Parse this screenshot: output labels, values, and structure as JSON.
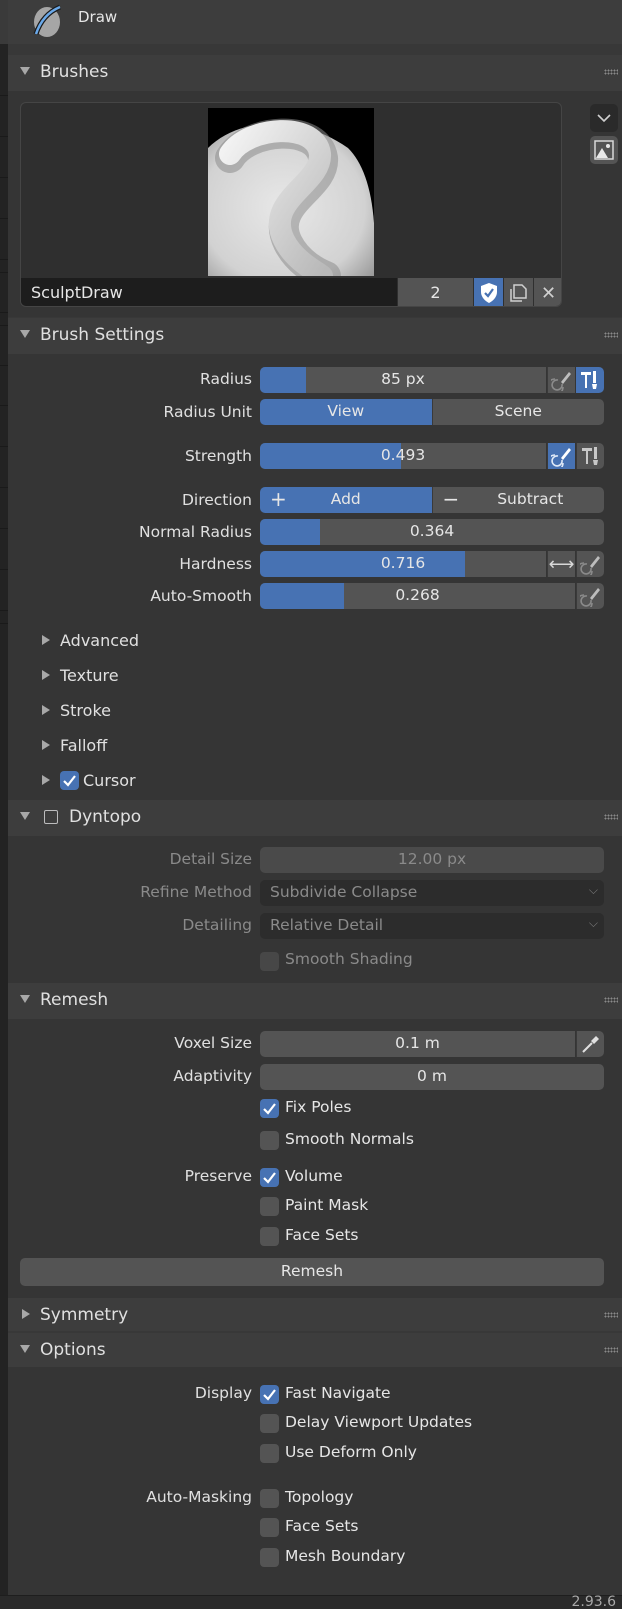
{
  "tool": {
    "name": "Draw",
    "icon": "draw-brush-icon"
  },
  "colors": {
    "accent": "#4772b3",
    "panel": "#383838",
    "header": "#3d3d3d",
    "field": "#545454"
  },
  "brushes": {
    "title": "Brushes",
    "brush_name": "SculptDraw",
    "users": "2",
    "fake_user_icon": "shield-check-icon",
    "duplicate_icon": "duplicate-icon",
    "delete_icon": "close-icon",
    "delete_glyph": "✕",
    "side_icons": [
      "chevron-down-icon",
      "image-icon"
    ]
  },
  "brush_settings": {
    "title": "Brush Settings",
    "radius": {
      "label": "Radius",
      "value": "85 px",
      "fill_fraction": 0.16
    },
    "radius_unit": {
      "label": "Radius Unit",
      "options": [
        "View",
        "Scene"
      ],
      "selected": "View"
    },
    "strength": {
      "label": "Strength",
      "value": "0.493",
      "fill_fraction": 0.493
    },
    "direction": {
      "label": "Direction",
      "options": [
        {
          "symbol": "+",
          "label": "Add"
        },
        {
          "symbol": "−",
          "label": "Subtract"
        }
      ],
      "selected": "Add"
    },
    "normal_radius": {
      "label": "Normal Radius",
      "value": "0.364",
      "fill_fraction": 0.175
    },
    "hardness": {
      "label": "Hardness",
      "value": "0.716",
      "fill_fraction": 0.716,
      "arrows_glyph": "⟷"
    },
    "auto_smooth": {
      "label": "Auto-Smooth",
      "value": "0.268",
      "fill_fraction": 0.268
    },
    "subpanels": [
      {
        "label": "Advanced"
      },
      {
        "label": "Texture"
      },
      {
        "label": "Stroke"
      },
      {
        "label": "Falloff"
      },
      {
        "label": "Cursor",
        "checkbox": true,
        "checked": true
      }
    ]
  },
  "dyntopo": {
    "title": "Dyntopo",
    "enabled": false,
    "detail_size": {
      "label": "Detail Size",
      "value": "12.00 px"
    },
    "refine_method": {
      "label": "Refine Method",
      "value": "Subdivide Collapse"
    },
    "detailing": {
      "label": "Detailing",
      "value": "Relative Detail"
    },
    "smooth_shading": {
      "label": "Smooth Shading",
      "checked": false
    }
  },
  "remesh": {
    "title": "Remesh",
    "voxel_size": {
      "label": "Voxel Size",
      "value": "0.1 m"
    },
    "adaptivity": {
      "label": "Adaptivity",
      "value": "0 m"
    },
    "fix_poles": {
      "label": "Fix Poles",
      "checked": true
    },
    "smooth_normals": {
      "label": "Smooth Normals",
      "checked": false
    },
    "preserve_label": "Preserve",
    "preserve": [
      {
        "label": "Volume",
        "checked": true
      },
      {
        "label": "Paint Mask",
        "checked": false
      },
      {
        "label": "Face Sets",
        "checked": false
      }
    ],
    "button": "Remesh"
  },
  "symmetry": {
    "title": "Symmetry"
  },
  "options": {
    "title": "Options",
    "display_label": "Display",
    "display": [
      {
        "label": "Fast Navigate",
        "checked": true
      },
      {
        "label": "Delay Viewport Updates",
        "checked": false
      },
      {
        "label": "Use Deform Only",
        "checked": false
      }
    ],
    "automasking_label": "Auto-Masking",
    "automasking": [
      {
        "label": "Topology",
        "checked": false
      },
      {
        "label": "Face Sets",
        "checked": false
      },
      {
        "label": "Mesh Boundary",
        "checked": false
      }
    ]
  },
  "status": {
    "version": "2.93.6"
  }
}
